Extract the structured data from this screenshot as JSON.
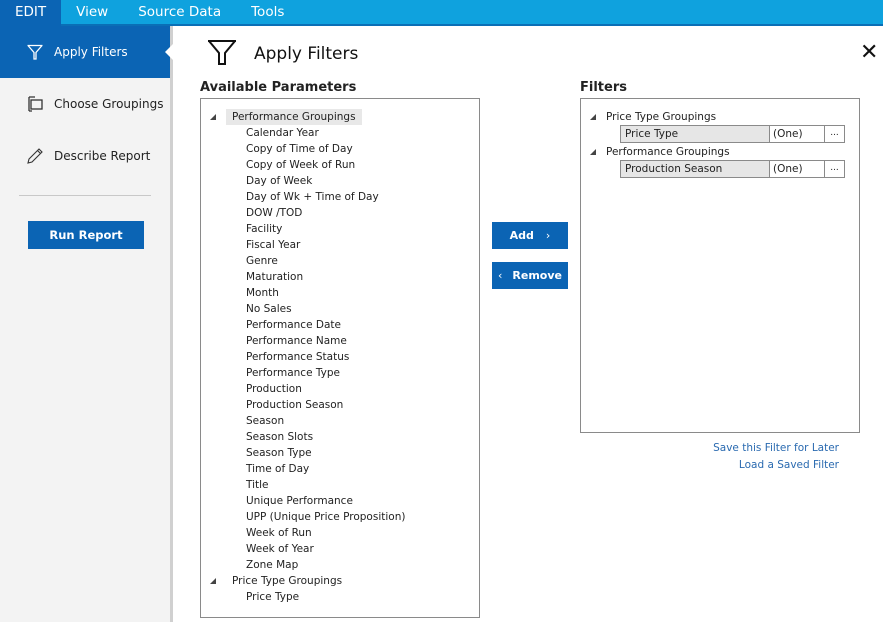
{
  "menubar": {
    "items": [
      {
        "label": "EDIT",
        "active": true
      },
      {
        "label": "View",
        "active": false
      },
      {
        "label": "Source Data",
        "active": false
      },
      {
        "label": "Tools",
        "active": false
      }
    ]
  },
  "sidebar": {
    "items": [
      {
        "label": "Apply Filters",
        "icon": "filter-icon",
        "active": true
      },
      {
        "label": "Choose Groupings",
        "icon": "groupings-icon",
        "active": false
      },
      {
        "label": "Describe Report",
        "icon": "pencil-icon",
        "active": false
      }
    ],
    "run_button": "Run Report"
  },
  "main": {
    "title": "Apply Filters",
    "close_label": "✕",
    "available": {
      "label": "Available Parameters",
      "groups": [
        {
          "label": "Performance Groupings",
          "items": [
            "Calendar Year",
            "Copy of Time of Day",
            "Copy of Week of Run",
            "Day of Week",
            "Day of Wk + Time of Day",
            "DOW /TOD",
            "Facility",
            "Fiscal Year",
            "Genre",
            "Maturation",
            "Month",
            "No Sales",
            "Performance Date",
            "Performance Name",
            "Performance Status",
            "Performance Type",
            "Production",
            "Production Season",
            "Season",
            "Season Slots",
            "Season Type",
            "Time of Day",
            "Title",
            "Unique Performance",
            "UPP (Unique Price Proposition)",
            "Week of Run",
            "Week of Year",
            "Zone Map"
          ]
        },
        {
          "label": "Price Type Groupings",
          "items": [
            "Price Type"
          ]
        }
      ]
    },
    "add_button": "Add",
    "remove_button": "Remove",
    "filters": {
      "label": "Filters",
      "groups": [
        {
          "label": "Price Type Groupings",
          "rows": [
            {
              "name": "Price Type",
              "value": "(One)",
              "more": "..."
            }
          ]
        },
        {
          "label": "Performance Groupings",
          "rows": [
            {
              "name": "Production Season",
              "value": "(One)",
              "more": "..."
            }
          ]
        }
      ]
    },
    "save_link": "Save this Filter for Later",
    "load_link": "Load a Saved Filter"
  }
}
